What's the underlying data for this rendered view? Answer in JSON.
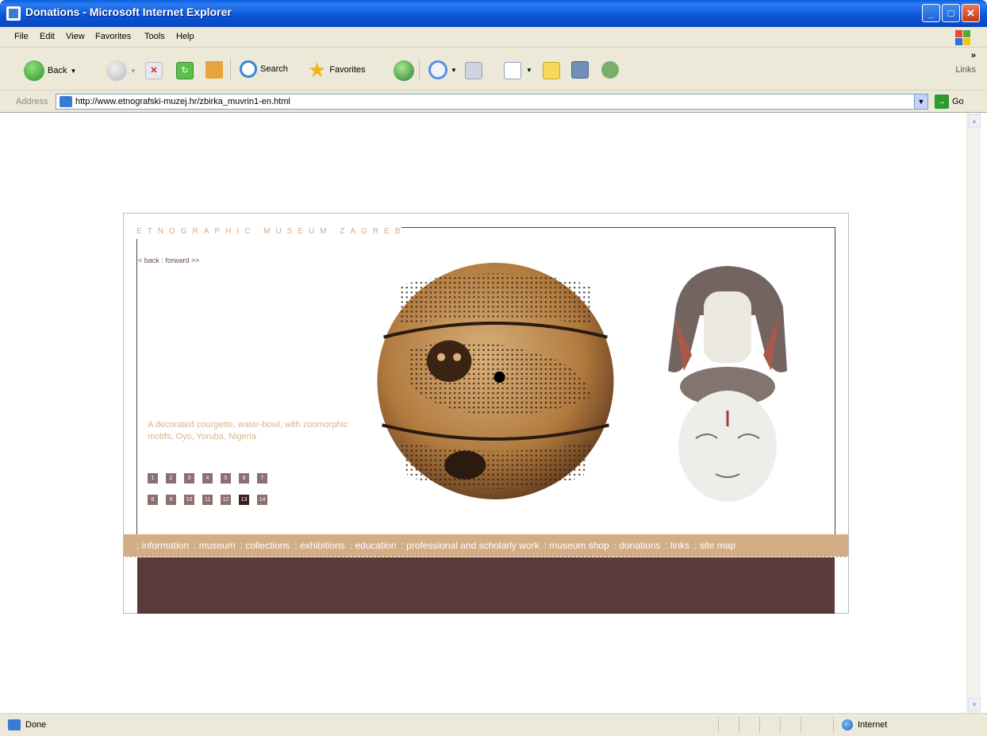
{
  "window": {
    "title": "Donations - Microsoft Internet Explorer",
    "minimize": "_",
    "maximize": "□",
    "close": "✕"
  },
  "menu": {
    "file": "File",
    "edit": "Edit",
    "view": "View",
    "favorites": "Favorites",
    "tools": "Tools",
    "help": "Help"
  },
  "toolbar": {
    "back_label": "Back",
    "search_label": "Search",
    "favorites_label": "Favorites",
    "links_label": "Links",
    "more": "»"
  },
  "address": {
    "label": "Address",
    "url": "http://www.etnografski-muzej.hr/zbirka_muvrin1-en.html",
    "go_label": "Go"
  },
  "site": {
    "title": "ETNOGRAPHIC MUSEUM ZAGREB",
    "back_link": "< back",
    "separator": ":",
    "forward_link": "forward >>",
    "caption": "A decorated courgette, water-bowl, with zoomorphic motifs, Oyo, Yoruba, Nigeria",
    "thumbnails": [
      "1",
      "2",
      "3",
      "4",
      "5",
      "6",
      "7",
      "8",
      "9",
      "10",
      "11",
      "12",
      "13",
      "14"
    ],
    "active_thumbnail": "13",
    "nav": [
      ": information",
      ": museum",
      ": collections",
      ": exhibitions",
      ": education",
      ": professional and scholarly work",
      ": museum shop",
      ": donations",
      ": links",
      ": site map"
    ]
  },
  "status": {
    "text": "Done",
    "zone": "Internet"
  }
}
